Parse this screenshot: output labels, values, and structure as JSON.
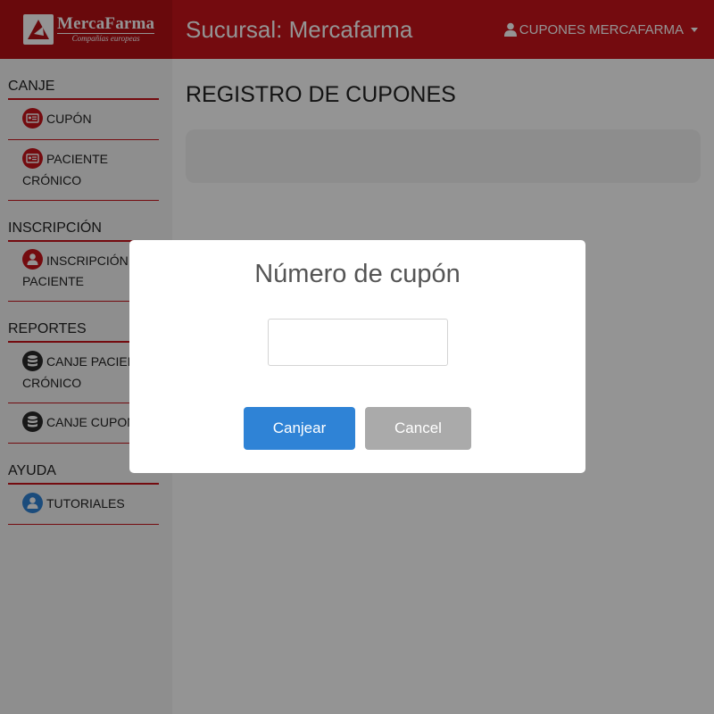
{
  "header": {
    "logo_name": "MercaFarma",
    "logo_subtitle": "Compañías europeas",
    "title": "Sucursal: Mercafarma",
    "user_label": "CUPONES MERCAFARMA",
    "brand_color": "#c9141a"
  },
  "sidebar": {
    "sections": [
      {
        "title": "CANJE",
        "items": [
          {
            "label": "CUPÓN",
            "icon": "id-card-icon"
          },
          {
            "label": "PACIENTE CRÓNICO",
            "icon": "id-card-icon"
          }
        ]
      },
      {
        "title": "INSCRIPCIÓN",
        "items": [
          {
            "label": "INSCRIPCIÓN DE PACIENTE",
            "icon": "user-icon"
          }
        ]
      },
      {
        "title": "REPORTES",
        "items": [
          {
            "label": "CANJE PACIENTE CRÓNICO",
            "icon": "database-icon"
          },
          {
            "label": "CANJE CUPONES",
            "icon": "database-icon"
          }
        ]
      },
      {
        "title": "AYUDA",
        "items": [
          {
            "label": "TUTORIALES",
            "icon": "user-icon"
          }
        ]
      }
    ]
  },
  "main": {
    "page_title": "REGISTRO DE CUPONES"
  },
  "modal": {
    "title": "Número de cupón",
    "input_value": "",
    "confirm_label": "Canjear",
    "cancel_label": "Cancel",
    "confirm_color": "#2f83d6",
    "cancel_color": "#aaaaaa"
  }
}
